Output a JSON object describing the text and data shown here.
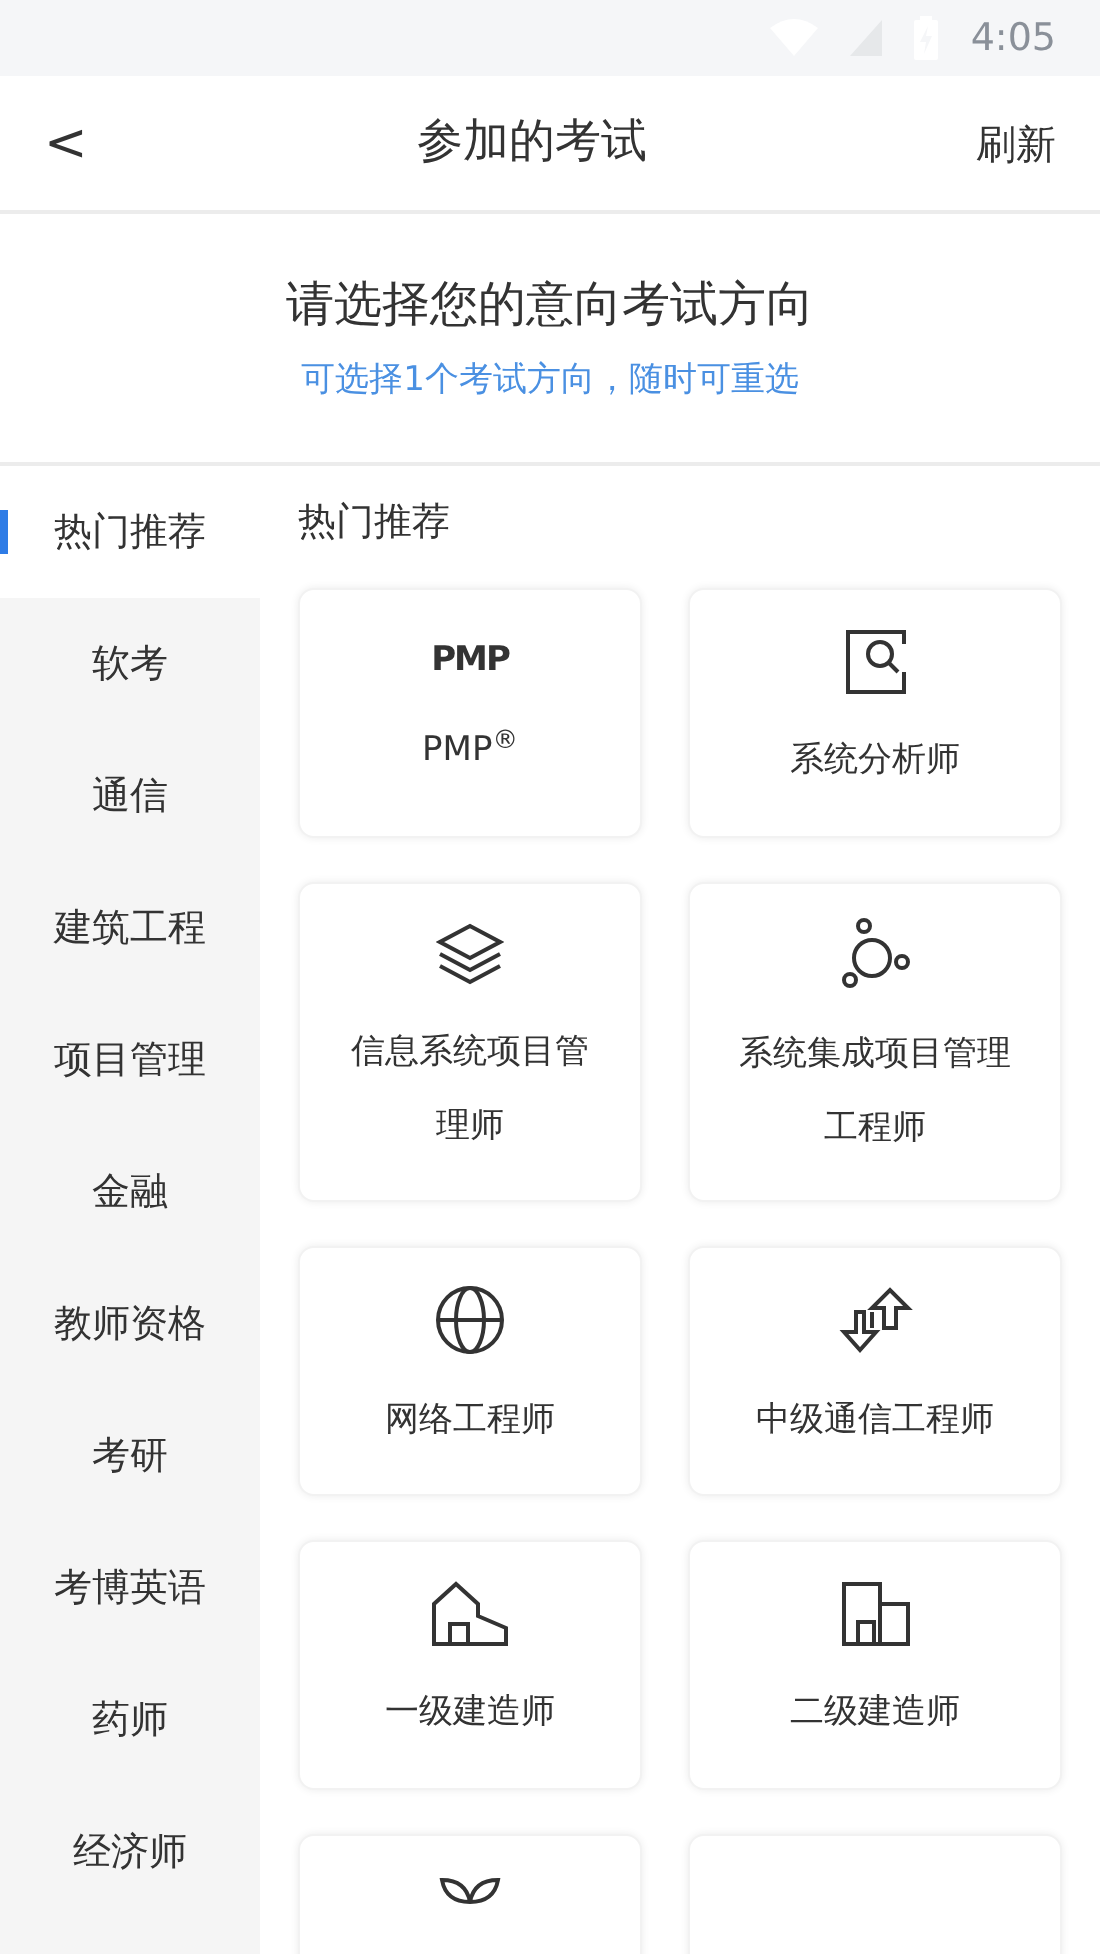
{
  "status_bar": {
    "time": "4:05"
  },
  "header": {
    "back": "<",
    "title": "参加的考试",
    "action": "刷新"
  },
  "intro": {
    "title": "请选择您的意向考试方向",
    "subtitle": "可选择1个考试方向，随时可重选"
  },
  "sidebar": {
    "items": [
      {
        "label": "热门推荐",
        "selected": true
      },
      {
        "label": "软考",
        "selected": false
      },
      {
        "label": "通信",
        "selected": false
      },
      {
        "label": "建筑工程",
        "selected": false
      },
      {
        "label": "项目管理",
        "selected": false
      },
      {
        "label": "金融",
        "selected": false
      },
      {
        "label": "教师资格",
        "selected": false
      },
      {
        "label": "考研",
        "selected": false
      },
      {
        "label": "考博英语",
        "selected": false
      },
      {
        "label": "药师",
        "selected": false
      },
      {
        "label": "经济师",
        "selected": false
      }
    ]
  },
  "section": {
    "title": "热门推荐",
    "cards": [
      {
        "kind": "wordmark",
        "icon_text": "PMP",
        "label": "PMP$^{®}$"
      },
      {
        "kind": "search-doc",
        "label": "系统分析师"
      },
      {
        "kind": "layers",
        "label": "信息系统项目管理师"
      },
      {
        "kind": "orbit",
        "label": "系统集成项目管理工程师"
      },
      {
        "kind": "globe",
        "label": "网络工程师"
      },
      {
        "kind": "arrows",
        "label": "中级通信工程师"
      },
      {
        "kind": "house",
        "label": "一级建造师"
      },
      {
        "kind": "building",
        "label": "二级建造师"
      },
      {
        "kind": "leaf"
      },
      {
        "kind": "blank"
      }
    ]
  }
}
